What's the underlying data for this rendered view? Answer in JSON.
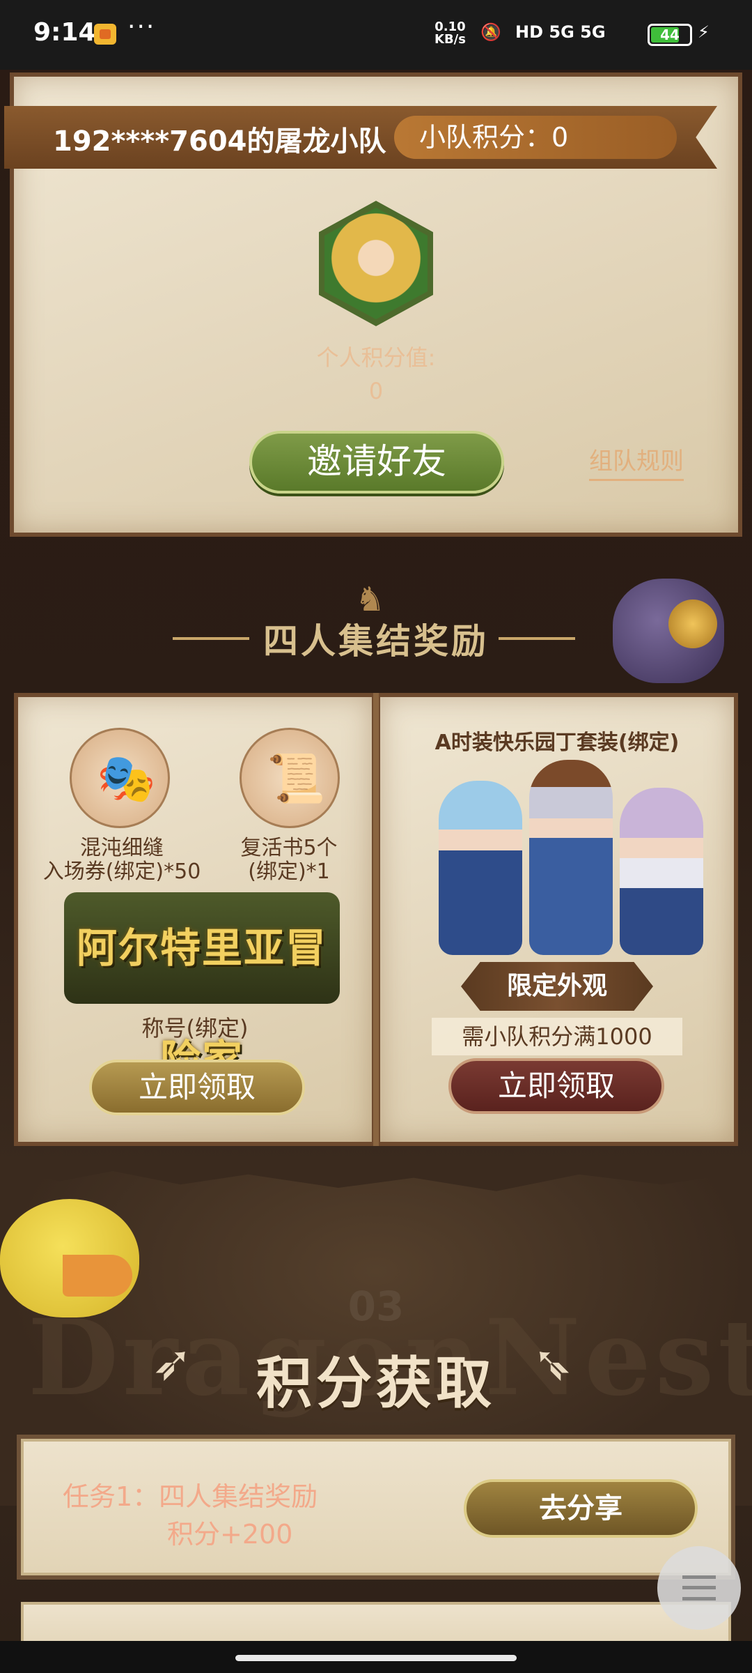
{
  "status_bar": {
    "time": "9:14",
    "more": "···",
    "speed_top": "0.10",
    "speed_bottom": "KB/s",
    "network": "HD 5G 5G",
    "battery": "44",
    "icons": [
      "app-notification-icon",
      "mute-icon",
      "hd-voice-icon",
      "signal-5g-icon",
      "signal-5g-icon",
      "battery-icon",
      "charging-icon"
    ]
  },
  "team": {
    "name": "192****7604的屠龙小队",
    "score_text": "小队积分：0",
    "personal_label": "个人积分值:",
    "personal_value": "0",
    "invite_button": "邀请好友",
    "rules_link": "组队规则"
  },
  "reward_section": {
    "title": "四人集结奖励",
    "left_page": {
      "items": [
        {
          "icon": "mask-icon",
          "label_line1": "混沌细缝",
          "label_line2": "入场券(绑定)*50"
        },
        {
          "icon": "revive-book-icon",
          "label_line1": "复活书5个",
          "label_line2": "(绑定)*1"
        }
      ],
      "title_badge": "阿尔特里亚冒险家",
      "title_label": "称号(绑定)",
      "claim_button": "立即领取"
    },
    "right_page": {
      "costume_title": "A时装快乐园丁套装(绑定)",
      "limited_badge": "限定外观",
      "requirement": "需小队积分满1000",
      "claim_button": "立即领取"
    }
  },
  "points_section": {
    "number": "03",
    "title": "积分获取",
    "background_text": "DragonNest",
    "task1": {
      "line1": "任务1：四人集结奖励",
      "line2": "积分+200",
      "button": "去分享"
    }
  },
  "colors": {
    "parchment": "#e4d7bd",
    "frame": "#6e4a2e",
    "invite_green": "#6a8a38",
    "claim_gold": "#9a7e3e",
    "claim_red": "#6a2c26",
    "task_text": "#f3a98a"
  }
}
